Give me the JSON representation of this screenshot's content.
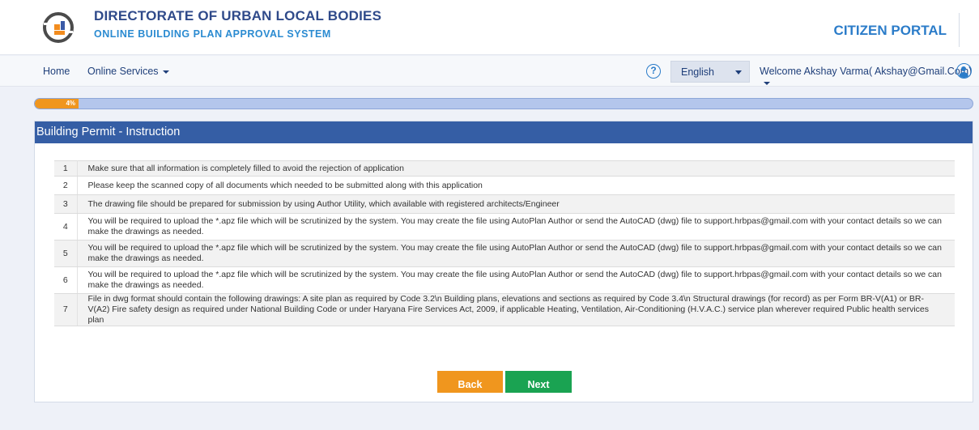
{
  "header": {
    "title": "DIRECTORATE OF URBAN LOCAL BODIES",
    "subtitle": "ONLINE BUILDING PLAN APPROVAL SYSTEM",
    "portal": "CITIZEN PORTAL"
  },
  "nav": {
    "home": "Home",
    "online_services": "Online Services",
    "help_glyph": "?",
    "language": "English",
    "welcome": "Welcome Akshay Varma( Akshay@Gmail.Com)"
  },
  "progress": {
    "label": "4%",
    "value": 0.04
  },
  "panel": {
    "heading": "Building Permit - Instruction"
  },
  "instructions": [
    {
      "num": "1",
      "text": "Make sure that all information is completely filled to avoid the rejection of application"
    },
    {
      "num": "2",
      "text": "Please keep the scanned copy of all documents which needed to be submitted along with this application"
    },
    {
      "num": "3",
      "text": "The drawing file should be prepared for submission by using Author Utility, which available with registered architects/Engineer"
    },
    {
      "num": "4",
      "text": "You will be required to upload the *.apz file which will be scrutinized by the system. You may create the file using AutoPlan Author or send the AutoCAD (dwg) file to support.hrbpas@gmail.com with your contact details so we can make the drawings as needed."
    },
    {
      "num": "5",
      "text": "You will be required to upload the *.apz file which will be scrutinized by the system. You may create the file using AutoPlan Author or send the AutoCAD (dwg) file to support.hrbpas@gmail.com with your contact details so we can make the drawings as needed."
    },
    {
      "num": "6",
      "text": "You will be required to upload the *.apz file which will be scrutinized by the system. You may create the file using AutoPlan Author or send the AutoCAD (dwg) file to support.hrbpas@gmail.com with your contact details so we can make the drawings as needed."
    },
    {
      "num": "7",
      "text": "File in dwg format should contain the following drawings: A site plan as required by Code 3.2\\n Building plans, elevations and sections as required by Code 3.4\\n Structural drawings (for record) as per Form BR-V(A1) or BR-V(A2) Fire safety design as required under National Building Code or under Haryana Fire Services Act, 2009, if applicable Heating, Ventilation, Air-Conditioning (H.V.A.C.) service plan wherever required Public health services plan"
    }
  ],
  "buttons": {
    "back": "Back",
    "next": "Next"
  },
  "colors": {
    "brand_blue": "#2f4a8a",
    "accent_blue": "#2b7cc9",
    "panel_heading": "#355ea5",
    "back_button": "#f0961e",
    "next_button": "#1aa352"
  },
  "icons": {
    "logo": "urban-local-bodies-logo",
    "help": "help-circle-icon",
    "user": "user-circle-icon"
  }
}
